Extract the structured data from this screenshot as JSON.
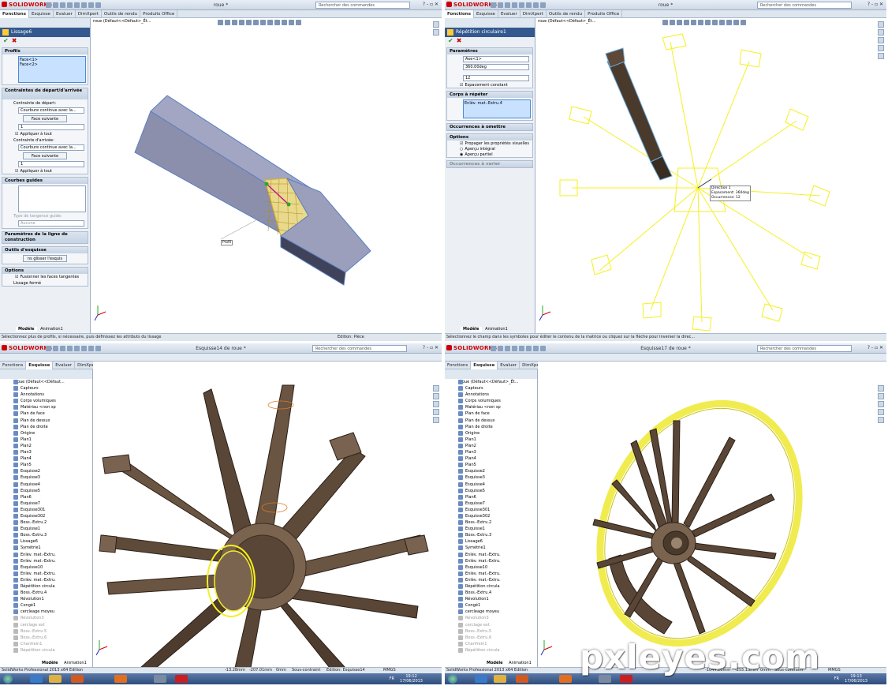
{
  "app": {
    "name": "SOLIDWORKS",
    "search_placeholder": "Rechercher des commandes",
    "edition": "SolidWorks Professional 2013 x64 Edition"
  },
  "tabs_cm": [
    "Fonctions",
    "Esquisse",
    "Evaluer",
    "DimXpert",
    "Outils de rendu",
    "Produits Office"
  ],
  "q1": {
    "title": "roue *",
    "tree_root": "roue (Défaut<<Défaut>_Ét...",
    "pm_title": "Lissage6",
    "profils": {
      "header": "Profils",
      "items": [
        "Face<1>",
        "Face<2>"
      ]
    },
    "contraintes": {
      "header": "Contraintes de départ/d'arrivée",
      "depart_label": "Contrainte de départ:",
      "depart_value": "Courbure continue avec la...",
      "depart_num": "1",
      "face_btn": "Face suivante",
      "apply_all": "Appliquer à tout",
      "arrivee_label": "Contrainte d'arrivée:",
      "arrivee_value": "Courbure continue avec la..."
    },
    "courbes": {
      "header": "Courbes guides",
      "tangence_label": "Type de tangence guide:",
      "tangence_value": "Aucune"
    },
    "ligne": "Paramètres de la ligne de construction",
    "outils": {
      "header": "Outils d'esquisse",
      "btn": "ns glisser l'esquis"
    },
    "options": {
      "header": "Options",
      "fusion": "Fusionner les faces tangentes",
      "ferme": "Lissage fermé"
    },
    "callout": "Profil",
    "status": "Sélectionnez plus de profils, si nécessaire, puis définissez les attributs du lissage",
    "status_mode": "Edition: Pièce",
    "bottom_tabs": [
      "Modèle",
      "Animation1"
    ]
  },
  "q2": {
    "title": "roue *",
    "tree_root": "roue (Défaut<<Défaut>_Ét...",
    "pm_title": "Répétition circulaire1",
    "params": {
      "header": "Paramètres",
      "axe": "Axe<1>",
      "angle": "360.00deg",
      "count": "12",
      "equal": "Espacement constant"
    },
    "corps": {
      "header": "Corps à répéter",
      "item": "Enlèv. mat.-Extru.4"
    },
    "occ": "Occurrences à omettre",
    "options": {
      "header": "Options",
      "prop": "Propager les propriétés visuelles",
      "integral": "Aperçu intégral",
      "partiel": "Aperçu partiel"
    },
    "repart": "Occurrences à varier",
    "callout": [
      "Direction 1",
      "Espacement: 360deg",
      "Occurrences: 12"
    ],
    "status": "Sélectionnez le champ dans les symboles pour éditer le contenu de la matrice ou cliquez sur la flèche pour inverser la direc...",
    "status_mode": "Edition: Pièce",
    "bottom_tabs": [
      "Modèle",
      "Animation1"
    ]
  },
  "q3": {
    "title": "Esquisse14 de roue *",
    "tree_root": "roue (Défaut<<Défaut...",
    "tree": [
      "Capteurs",
      "Annotations",
      "Corps volumiques",
      "Matériau <non sp",
      "Plan de face",
      "Plan de dessus",
      "Plan de droite",
      "Origine",
      "Plan1",
      "Plan2",
      "Plan3",
      "Plan4",
      "Plan5",
      "Esquisse2",
      "Esquisse3",
      "Esquisse4",
      "Esquisse5",
      "Plan6",
      "Esquisse7",
      "Esquisse301",
      "Esquisse302",
      "Boss.-Extru.2",
      "Esquisse1",
      "Boss.-Extru.3",
      "Lissage6",
      "Symétrie1",
      "Enlèv. mat.-Extru.",
      "Enlèv. mat.-Extru.",
      "Esquisse10",
      "Enlèv. mat.-Extru.",
      "Enlèv. mat.-Extru.",
      "Répétition circula",
      "Boss.-Extru.4",
      "Révolution1",
      "Congé1",
      "cercleage moyeu",
      "Révolution3",
      "cerclage ext",
      "Boss.-Extru.5",
      "Boss.-Extru.6",
      "Chanfrein1",
      "Répétition circula"
    ],
    "status_coords": [
      "-13.28mm",
      "-207.01mm",
      "0mm",
      "Sous-contraint",
      "Edition: Esquisse14",
      "MMGS"
    ],
    "bottom_tabs": [
      "Modèle",
      "Animation1"
    ],
    "clock": [
      "19:12",
      "17/06/2013"
    ],
    "lang": "FR"
  },
  "q4": {
    "title": "Esquisse17 de roue *",
    "tree_root": "roue (Défaut<<Défaut>_Ét...",
    "tree": [
      "Capteurs",
      "Annotations",
      "Corps volumiques",
      "Matériau <non sp",
      "Plan de face",
      "Plan de dessus",
      "Plan de droite",
      "Origine",
      "Plan1",
      "Plan2",
      "Plan3",
      "Plan4",
      "Plan5",
      "Esquisse2",
      "Esquisse3",
      "Esquisse4",
      "Esquisse5",
      "Plan6",
      "Esquisse7",
      "Esquisse301",
      "Esquisse302",
      "Boss.-Extru.2",
      "Esquisse1",
      "Boss.-Extru.3",
      "Lissage6",
      "Symétrie1",
      "Enlèv. mat.-Extru.",
      "Enlèv. mat.-Extru.",
      "Esquisse10",
      "Enlèv. mat.-Extru.",
      "Enlèv. mat.-Extru.",
      "Répétition circula",
      "Boss.-Extru.4",
      "Révolution1",
      "Congé1",
      "cercleage moyeu",
      "Révolution3",
      "cerclage ext",
      "Boss.-Extru.5",
      "Boss.-Extru.6",
      "Chanfrein1",
      "Répétition circula"
    ],
    "status_coords": [
      "-1044.26mm",
      "-255.13mm",
      "0mm",
      "Sous-contraint",
      "MMGS"
    ],
    "bottom_tabs": [
      "Modèle",
      "Animation1"
    ],
    "clock": [
      "19:13",
      "17/06/2013"
    ],
    "lang": "FR"
  },
  "watermark": "pxleyes.com",
  "colors": {
    "accent": "#34598f",
    "wood": "#5a4636",
    "highlight": "#ffff33",
    "select": "#2a7bd8"
  }
}
